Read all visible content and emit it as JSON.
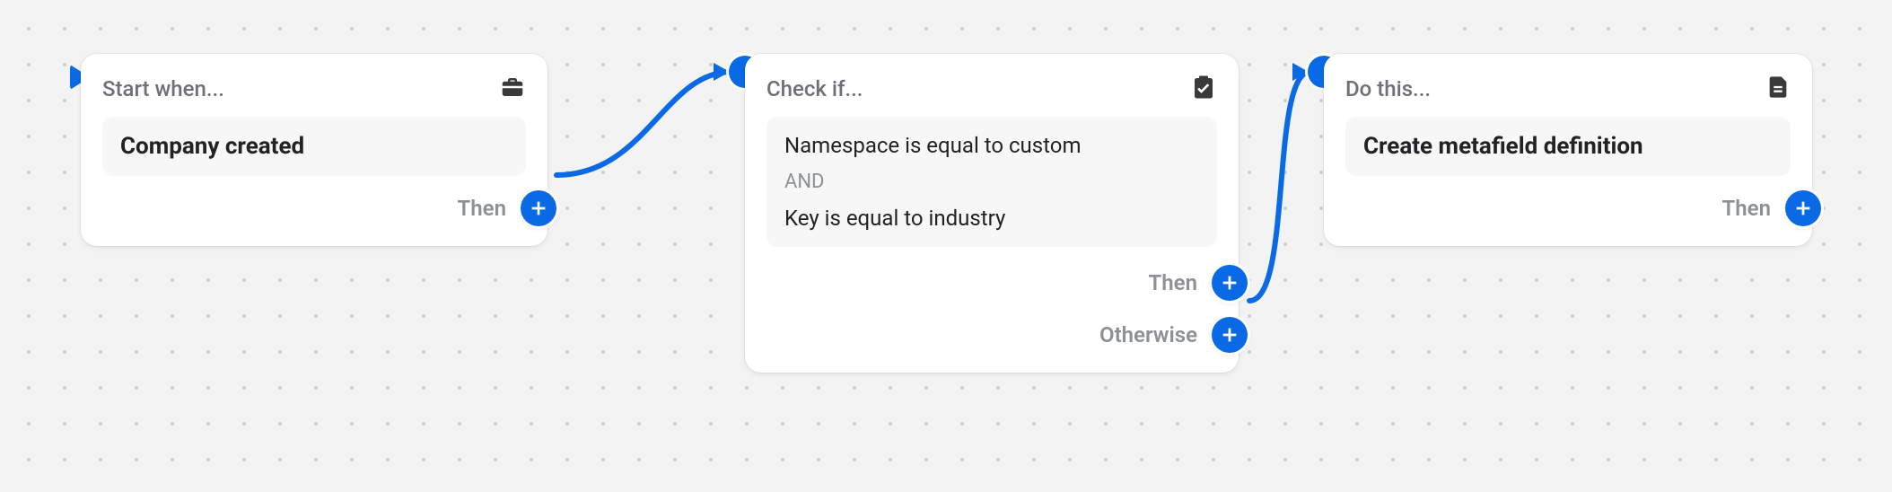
{
  "nodes": {
    "trigger": {
      "header": "Start when...",
      "title": "Company created",
      "then_label": "Then"
    },
    "condition": {
      "header": "Check if...",
      "line1": "Namespace is equal to custom",
      "op": "AND",
      "line2": "Key is equal to industry",
      "then_label": "Then",
      "otherwise_label": "Otherwise"
    },
    "action": {
      "header": "Do this...",
      "title": "Create metafield definition",
      "then_label": "Then"
    }
  }
}
